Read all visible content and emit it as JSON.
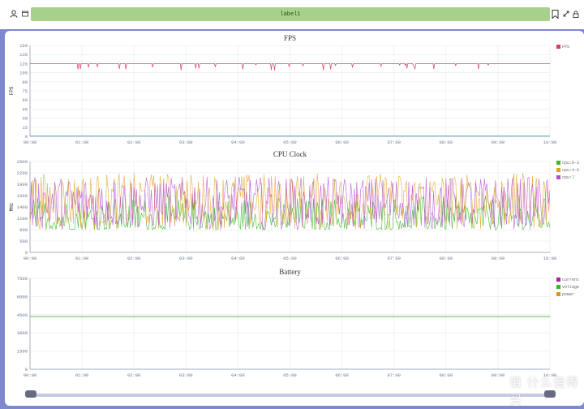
{
  "toolbar": {
    "label_text": "label1",
    "left_icons": [
      "user-icon",
      "window-icon"
    ],
    "right_icons": [
      "bookmark-icon",
      "resize-icon",
      "lock-icon"
    ]
  },
  "watermark": "值 什么值得买",
  "charts": [
    {
      "title": "FPS",
      "ylabel": "FPS",
      "yticks": [
        "0",
        "15",
        "30",
        "45",
        "60",
        "75",
        "90",
        "105",
        "120",
        "135",
        "150"
      ],
      "xticks": [
        "00:00",
        "01:00",
        "02:00",
        "03:00",
        "04:00",
        "05:00",
        "06:00",
        "07:00",
        "08:00",
        "09:00",
        "10:00"
      ],
      "legend": [
        {
          "name": "FPS",
          "color": "#d4415a"
        }
      ]
    },
    {
      "title": "CPU Clock",
      "ylabel": "MHz",
      "yticks": [
        "0",
        "500",
        "800",
        "1100",
        "1400",
        "1600",
        "1900",
        "2200",
        "2500"
      ],
      "xticks": [
        "00:00",
        "01:00",
        "02:00",
        "03:00",
        "04:00",
        "05:00",
        "06:00",
        "07:00",
        "08:00",
        "09:00",
        "10:00"
      ],
      "legend": [
        {
          "name": "cpu:0-3",
          "color": "#3db82c"
        },
        {
          "name": "cpu:4-6",
          "color": "#e0a020"
        },
        {
          "name": "cpu:7",
          "color": "#b44ad0"
        }
      ]
    },
    {
      "title": "Battery",
      "ylabel": "",
      "yticks": [
        "0",
        "1500",
        "3000",
        "4500",
        "6000",
        "7500"
      ],
      "xticks": [
        "00:00",
        "01:00",
        "02:00",
        "03:00",
        "04:00",
        "05:00",
        "06:00",
        "07:00",
        "08:00",
        "09:00",
        "10:00"
      ],
      "legend": [
        {
          "name": "current",
          "color": "#b01fa8"
        },
        {
          "name": "voltage",
          "color": "#3db82c"
        },
        {
          "name": "power",
          "color": "#e0902a"
        }
      ]
    }
  ],
  "chart_data": [
    {
      "type": "line",
      "title": "FPS",
      "ylabel": "FPS",
      "ylim": [
        0,
        150
      ],
      "xlim": [
        "00:00",
        "10:00"
      ],
      "series": [
        {
          "name": "FPS",
          "values_summary": "steady around 120 with brief dips to ~108",
          "baseline": 120,
          "dip_min": 108
        }
      ],
      "grid": true,
      "legend": "top-right"
    },
    {
      "type": "line",
      "title": "CPU Clock",
      "ylabel": "MHz",
      "ylim": [
        500,
        2500
      ],
      "xlim": [
        "00:00",
        "10:00"
      ],
      "series": [
        {
          "name": "cpu:0-3",
          "range": [
            800,
            1600
          ]
        },
        {
          "name": "cpu:4-6",
          "range": [
            800,
            2200
          ]
        },
        {
          "name": "cpu:7",
          "range": [
            800,
            2100
          ]
        }
      ],
      "grid": true,
      "legend": "top-right"
    },
    {
      "type": "line",
      "title": "Battery",
      "ylim": [
        0,
        7500
      ],
      "xlim": [
        "00:00",
        "10:00"
      ],
      "series": [
        {
          "name": "current",
          "values": []
        },
        {
          "name": "voltage",
          "constant": 4350
        },
        {
          "name": "power",
          "values": []
        }
      ],
      "grid": true,
      "legend": "top-right"
    }
  ]
}
